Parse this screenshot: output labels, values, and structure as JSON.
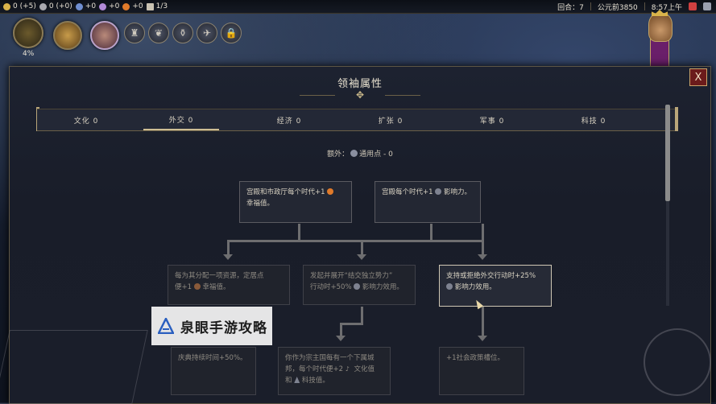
{
  "topbar": {
    "resources": [
      {
        "icon": "gold-icon",
        "text": "0 (+5)",
        "color": "#d9b34a"
      },
      {
        "icon": "production-icon",
        "text": "0 (+0)",
        "color": "#a9a9b0"
      },
      {
        "icon": "science-icon",
        "text": "+0",
        "color": "#6f8ed0"
      },
      {
        "icon": "culture-icon",
        "text": "+0",
        "color": "#b28ad8"
      },
      {
        "icon": "happiness-icon",
        "text": "+0",
        "color": "#e07a2a"
      },
      {
        "icon": "settlement-icon",
        "text": "1/3",
        "color": "#c9c2b2"
      }
    ],
    "turn_label": "回合：7",
    "year": "公元前3850",
    "time": "8:57上午"
  },
  "hud": {
    "age_progress": "4%"
  },
  "panel": {
    "title": "领袖属性",
    "close": "X",
    "tabs": [
      {
        "label": "文化 0",
        "active": false
      },
      {
        "label": "外交 0",
        "active": true
      },
      {
        "label": "经济 0",
        "active": false
      },
      {
        "label": "扩张 0",
        "active": false
      },
      {
        "label": "军事 0",
        "active": false
      },
      {
        "label": "科技 0",
        "active": false
      }
    ],
    "extra_prefix": "额外：",
    "extra_value": "通用点 - 0"
  },
  "tree": {
    "row1_left_a": "宫殿和市政厅每个时代+1",
    "row1_left_b": "幸福值。",
    "row1_right_a": "宫殿每个时代+1",
    "row1_right_b": "影响力。",
    "row2_left_a": "每为其分配一项资源，定居点",
    "row2_left_b": "便+1",
    "row2_left_c": "幸福值。",
    "row2_mid_a": "发起并展开“结交独立势力”",
    "row2_mid_b": "行动时+50%",
    "row2_mid_c": "影响力效用。",
    "row2_right_a": "支持或拒绝外交行动时+25%",
    "row2_right_b": "影响力效用。",
    "row3_left": "庆典持续时间+50%。",
    "row3_mid_a": "你作为宗主国每有一个下属城",
    "row3_mid_b": "邦，每个时代便+2",
    "row3_mid_c": "文化值",
    "row3_mid_d": "和",
    "row3_mid_e": "科技值。",
    "row3_right": "+1社会政策槽位。"
  },
  "watermark": {
    "text": "泉眼手游攻略"
  }
}
